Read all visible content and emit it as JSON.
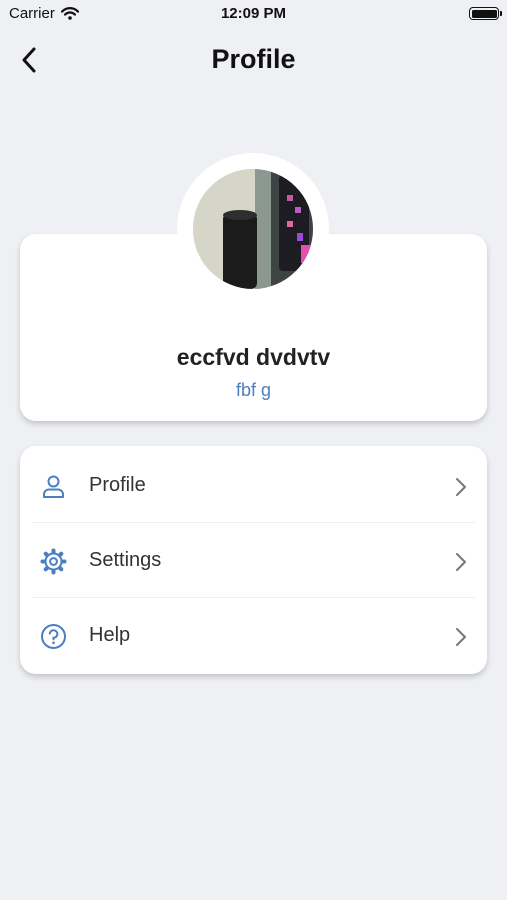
{
  "status_bar": {
    "carrier": "Carrier",
    "time": "12:09 PM"
  },
  "nav": {
    "title": "Profile"
  },
  "user": {
    "name": "eccfvd dvdvtv",
    "handle": "fbf g"
  },
  "menu": {
    "items": [
      {
        "label": "Profile",
        "icon": "user-icon"
      },
      {
        "label": "Settings",
        "icon": "gear-icon"
      },
      {
        "label": "Help",
        "icon": "help-circle-icon"
      }
    ]
  },
  "colors": {
    "accent": "#4a7fc0",
    "background": "#eff0f4",
    "card": "#ffffff"
  }
}
